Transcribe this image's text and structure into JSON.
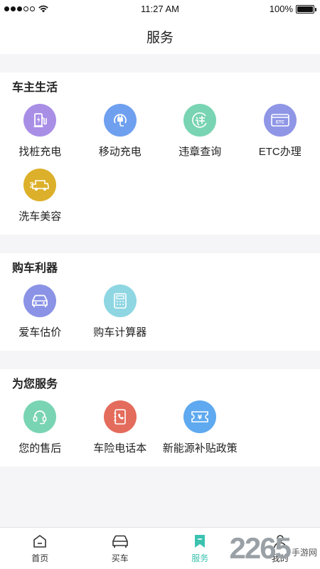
{
  "status": {
    "time": "11:27 AM",
    "battery": "100%"
  },
  "header": {
    "title": "服务"
  },
  "sections": [
    {
      "title": "车主生活",
      "items": [
        {
          "label": "找桩充电",
          "icon": "charging-pile-icon",
          "color": "#a98ee6"
        },
        {
          "label": "移动充电",
          "icon": "mobile-charge-icon",
          "color": "#6fa0ef"
        },
        {
          "label": "违章查询",
          "icon": "violation-icon",
          "color": "#79d4b3"
        },
        {
          "label": "ETC办理",
          "icon": "etc-card-icon",
          "color": "#8f96e6"
        },
        {
          "label": "洗车美容",
          "icon": "car-wash-icon",
          "color": "#dcb02a"
        }
      ]
    },
    {
      "title": "购车利器",
      "items": [
        {
          "label": "爱车估价",
          "icon": "car-valuation-icon",
          "color": "#8b93e6"
        },
        {
          "label": "购车计算器",
          "icon": "calculator-icon",
          "color": "#8fd6e3"
        }
      ]
    },
    {
      "title": "为您服务",
      "items": [
        {
          "label": "您的售后",
          "icon": "headset-icon",
          "color": "#79d4b3"
        },
        {
          "label": "车险电话本",
          "icon": "phonebook-icon",
          "color": "#e46c5c"
        },
        {
          "label": "新能源补贴政策",
          "icon": "subsidy-ticket-icon",
          "color": "#5ea9ef"
        }
      ]
    }
  ],
  "tabs": [
    {
      "label": "首页",
      "icon": "home-icon"
    },
    {
      "label": "买车",
      "icon": "car-icon"
    },
    {
      "label": "服务",
      "icon": "bookmark-icon",
      "active": true
    },
    {
      "label": "我的",
      "icon": "user-icon"
    }
  ],
  "watermark": {
    "number": "2265",
    "text": "手游网"
  },
  "etc_icon_text": "ETC",
  "yen_text": "¥",
  "accent": "#3cc2b0"
}
